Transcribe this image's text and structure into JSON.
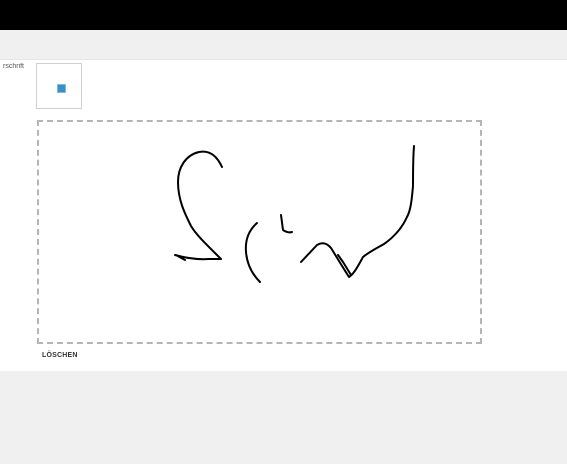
{
  "header": {},
  "form": {
    "field_label": "rschrift",
    "thumbnail_icon": "image-thumbnail-icon",
    "clear_label": "LÖSCHEN"
  },
  "colors": {
    "stroke": "#000000",
    "pad_border": "#b5b5b5",
    "top_bar": "#000000"
  }
}
